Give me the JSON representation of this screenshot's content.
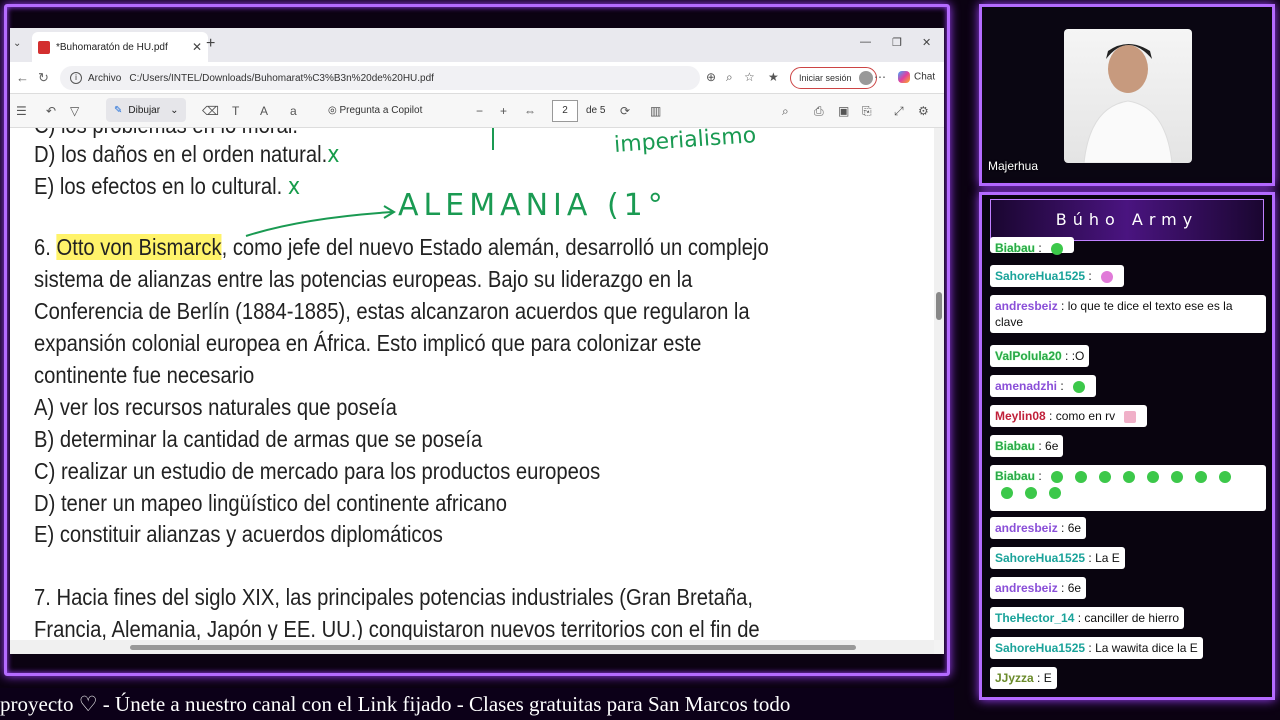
{
  "browser": {
    "tab_title": "*Buhomaratón de HU.pdf",
    "address_label": "Archivo",
    "url": "C:/Users/INTEL/Downloads/Buhomarat%C3%B3n%20de%20HU.pdf",
    "signin": "Iniciar sesión",
    "chat": "Chat"
  },
  "pdf_toolbar": {
    "draw": "Dibujar",
    "ask": "Pregunta a Copilot",
    "page": "2",
    "page_of": "de 5"
  },
  "doc": {
    "line_c": "C) los problemas en lo moral.",
    "line_d": "D) los daños en el orden natural.",
    "line_e": "E) los efectos en lo cultural.",
    "q6_num": "6.",
    "q6_highlight": "Otto von Bismarck",
    "q6_rest": ", como jefe del nuevo Estado alemán, desarrolló un complejo",
    "q6_l2": "sistema de alianzas entre las potencias europeas. Bajo su liderazgo en la",
    "q6_l3": "Conferencia de Berlín (1884-1885), estas alcanzaron acuerdos que regularon la",
    "q6_l4": "expansión colonial europea en África. Esto implicó que para colonizar este",
    "q6_l5": "continente fue necesario",
    "opt_a": "A) ver los recursos naturales que poseía",
    "opt_b": "B) determinar la cantidad de armas que se poseía",
    "opt_c": "C) realizar un estudio de mercado para los productos europeos",
    "opt_d": "D) tener un mapeo lingüístico del continente africano",
    "opt_e": "E) constituir alianzas y acuerdos diplomáticos",
    "q7_l1": "7. Hacia fines del siglo XIX, las principales potencias industriales (Gran Bretaña,",
    "q7_l2": "Francia, Alemania, Japón y EE. UU.) conquistaron nuevos territorios con el fin de",
    "annot_alemania": "ALEMANIA (1°",
    "annot_imperialismo": "imperialismo",
    "annot_x": "x"
  },
  "camera": {
    "name": "Majerhua"
  },
  "chat": {
    "title": "Búho Army",
    "messages": [
      {
        "user": "Biabau",
        "text": ""
      },
      {
        "user": "SahoreHua1525",
        "text": ""
      },
      {
        "user": "andresbeiz",
        "text": "lo que te dice el texto ese es la clave"
      },
      {
        "user": "ValPolula20",
        "text": ":O"
      },
      {
        "user": "amenadzhi",
        "text": ""
      },
      {
        "user": "Meylin08",
        "text": "como en rv"
      },
      {
        "user": "Biabau",
        "text": "6e"
      },
      {
        "user": "Biabau",
        "text": ""
      },
      {
        "user": "andresbeiz",
        "text": "6e"
      },
      {
        "user": "SahoreHua1525",
        "text": "La E"
      },
      {
        "user": "andresbeiz",
        "text": "6e"
      },
      {
        "user": "TheHector_14",
        "text": "canciller de hierro"
      },
      {
        "user": "SahoreHua1525",
        "text": "La wawita dice la E"
      },
      {
        "user": "JJyzza",
        "text": "E"
      }
    ]
  },
  "ticker": "proyecto ♡  -  Únete a nuestro canal con el Link fijado  -  Clases gratuitas para San Marcos todo"
}
